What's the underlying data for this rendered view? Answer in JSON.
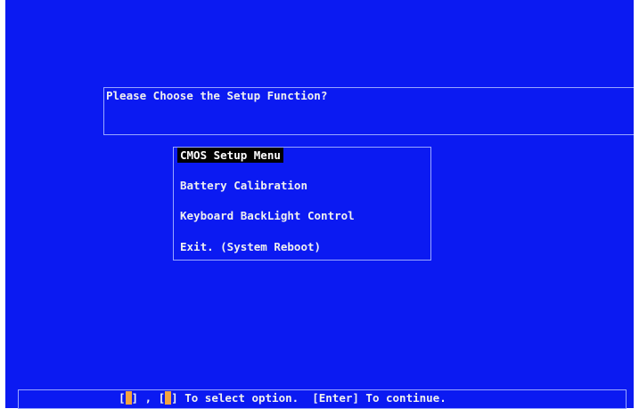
{
  "prompt": {
    "title": "Please Choose the Setup Function?"
  },
  "menu": {
    "items": [
      {
        "label": "CMOS Setup Menu",
        "selected": true
      },
      {
        "label": "Battery Calibration",
        "selected": false
      },
      {
        "label": "Keyboard BackLight Control",
        "selected": false
      },
      {
        "label": "Exit. (System Reboot)",
        "selected": false
      }
    ]
  },
  "status": {
    "bracket_open": "[",
    "bracket_close": "]",
    "separator": " , ",
    "select_hint": " To select option.  ",
    "enter_hint": "[Enter] To continue."
  },
  "colors": {
    "background": "#0b1af2",
    "text": "#f0f0f0",
    "highlight": "#000000",
    "key_marker": "#f4a440"
  }
}
